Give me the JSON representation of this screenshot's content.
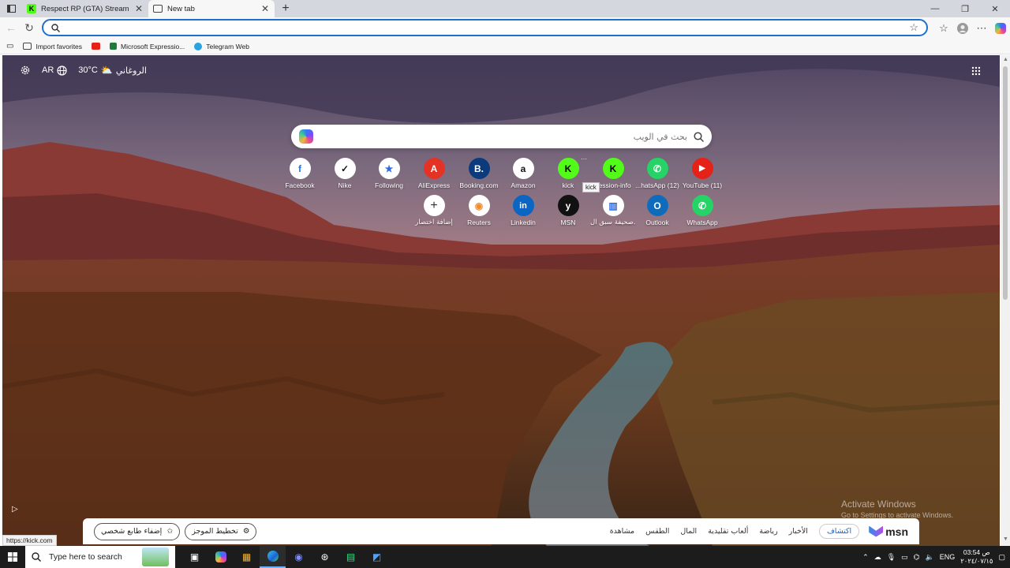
{
  "tabs": [
    {
      "label": "Respect RP (GTA) Streaming - Live",
      "favicon": "kick-icon",
      "active": false
    },
    {
      "label": "New tab",
      "favicon": "new-tab-icon",
      "active": true
    }
  ],
  "address_bar": {
    "value": "",
    "placeholder": ""
  },
  "favorites": [
    {
      "label": "Import favorites",
      "icon": "import-icon",
      "color": "#444444"
    },
    {
      "label": "",
      "icon": "youtube-icon",
      "color": "#e62117"
    },
    {
      "label": "Microsoft Expressio...",
      "icon": "excel-icon",
      "color": "#1f7a3e"
    },
    {
      "label": "Telegram Web",
      "icon": "telegram-icon",
      "color": "#2aa3e0"
    }
  ],
  "top_left": {
    "language": "AR",
    "temperature": "30°C",
    "city": "الروغاني"
  },
  "search": {
    "placeholder": "بحث في الويب"
  },
  "shortcuts_row1": [
    {
      "label": "Facebook",
      "glyph": "f",
      "color": "#1877f2"
    },
    {
      "label": "Nike",
      "glyph": "✓",
      "color": "#111111"
    },
    {
      "label": "Following",
      "glyph": "★",
      "color": "#2d6be4"
    },
    {
      "label": "AliExpress",
      "glyph": "A",
      "color": "#e43225"
    },
    {
      "label": "Booking.com",
      "glyph": "B.",
      "color": "#0c3b7c"
    },
    {
      "label": "Amazon",
      "glyph": "a",
      "color": "#111111"
    },
    {
      "label": "kick",
      "glyph": "K",
      "color": "#53fc18"
    },
    {
      "label": "session-info",
      "glyph": "K",
      "color": "#53fc18"
    },
    {
      "label": "...hatsApp (12)",
      "glyph": "✆",
      "color": "#25d366"
    },
    {
      "label": "YouTube (11)",
      "glyph": "▶",
      "color": "#e62117"
    }
  ],
  "shortcuts_row2": [
    {
      "label": "إضافة اختصار",
      "glyph": "+",
      "color": "#333333"
    },
    {
      "label": "Reuters",
      "glyph": "◉",
      "color": "#f08c2a"
    },
    {
      "label": "Linkedin",
      "glyph": "in",
      "color": "#0a66c2"
    },
    {
      "label": "MSN",
      "glyph": "y",
      "color": "#111111"
    },
    {
      "label": "صحيفة سبق ال...",
      "glyph": "▥",
      "color": "#2d6be4"
    },
    {
      "label": "Outlook",
      "glyph": "O",
      "color": "#0f6cbd"
    },
    {
      "label": "WhatsApp",
      "glyph": "✆",
      "color": "#25d366"
    }
  ],
  "tooltip": "kick",
  "msn_bar": {
    "personalize": "إضفاء طابع شخصي",
    "layout": "تخطيط الموجز",
    "nav": [
      "مشاهدة",
      "الطقس",
      "المال",
      "ألعاب تقليدية",
      "رياضة",
      "الأخبار"
    ],
    "active": "اكتشاف",
    "logo": "msn"
  },
  "status_url": "https://kick.com",
  "watermark": {
    "line1": "Activate Windows",
    "line2": "Go to Settings to activate Windows."
  },
  "taskbar": {
    "search_placeholder": "Type here to search",
    "lang": "ENG",
    "time": "03:54 ص",
    "date": "٢٠٢٤/٠٧/١٥"
  }
}
